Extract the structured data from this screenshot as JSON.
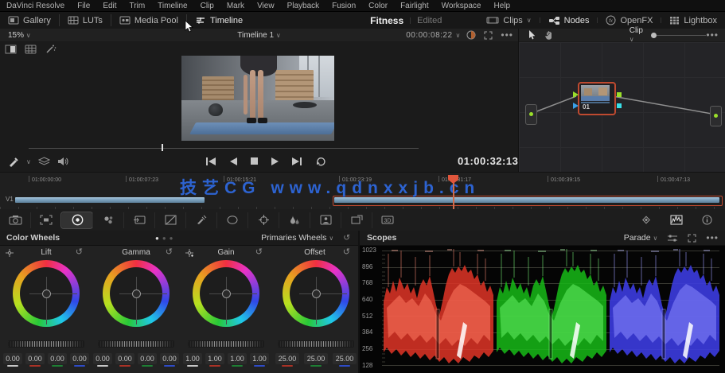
{
  "menu": {
    "items": [
      "DaVinci Resolve",
      "File",
      "Edit",
      "Trim",
      "Timeline",
      "Clip",
      "Mark",
      "View",
      "Playback",
      "Fusion",
      "Color",
      "Fairlight",
      "Workspace",
      "Help"
    ]
  },
  "toolbar": {
    "gallery": "Gallery",
    "luts": "LUTs",
    "media_pool": "Media Pool",
    "timeline": "Timeline",
    "project_title": "Fitness",
    "project_status": "Edited",
    "clips": "Clips",
    "nodes": "Nodes",
    "openfx": "OpenFX",
    "lightbox": "Lightbox"
  },
  "viewer": {
    "zoom_level": "15%",
    "timeline_name": "Timeline 1",
    "source_timecode": "00:00:08:22",
    "record_timecode": "01:00:32:13"
  },
  "node_panel": {
    "mode": "Clip",
    "node_label": "01"
  },
  "timeline": {
    "track_label": "V1",
    "ruler": [
      "01:00:00:00",
      "01:00:07:23",
      "01:00:15:21",
      "01:00:23:19",
      "01:00:31:17",
      "01:00:39:15",
      "01:00:47:13"
    ]
  },
  "watermark": {
    "text": "技艺CG www.qdnxxjb.cn"
  },
  "wheels": {
    "panel_title": "Color Wheels",
    "mode": "Primaries Wheels",
    "groups": [
      {
        "label": "Lift",
        "values": [
          "0.00",
          "0.00",
          "0.00",
          "0.00"
        ]
      },
      {
        "label": "Gamma",
        "values": [
          "0.00",
          "0.00",
          "0.00",
          "0.00"
        ]
      },
      {
        "label": "Gain",
        "values": [
          "1.00",
          "1.00",
          "1.00",
          "1.00"
        ]
      },
      {
        "label": "Offset",
        "values": [
          "25.00",
          "25.00",
          "25.00"
        ]
      }
    ]
  },
  "scopes": {
    "panel_title": "Scopes",
    "mode": "Parade",
    "axis": [
      "1023",
      "896",
      "768",
      "640",
      "512",
      "384",
      "256",
      "128"
    ]
  },
  "colors": {
    "accent_orange": "#e0563c",
    "selection_red": "#bf4a30",
    "clip_blue": "#8fb6d2",
    "watermark_blue": "#2d63d1",
    "scope_red": "#e03a2a",
    "scope_green": "#22c422",
    "scope_blue": "#4343ee"
  }
}
